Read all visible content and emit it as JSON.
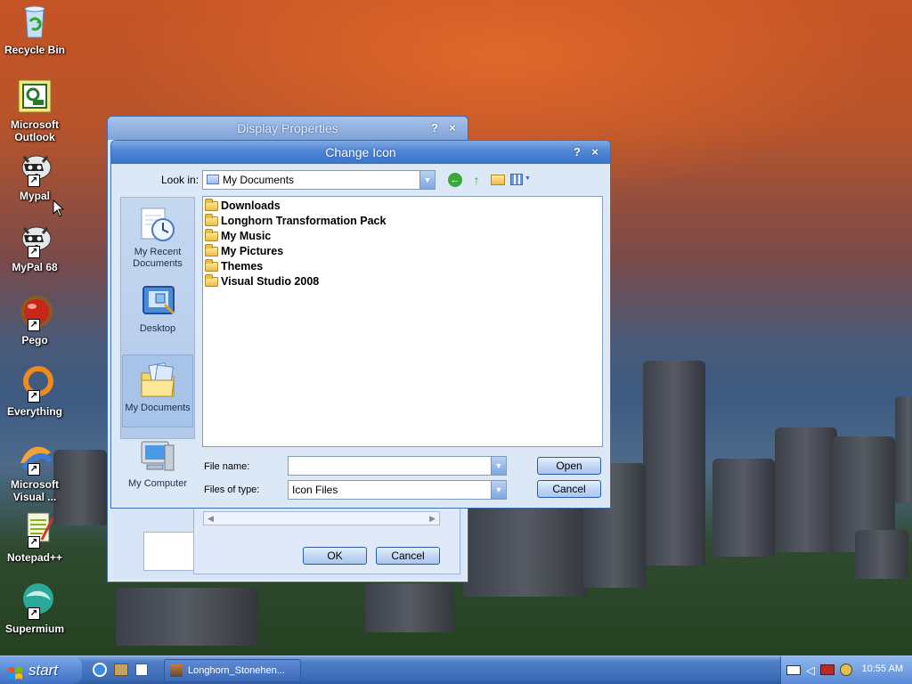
{
  "desktop": {
    "icons": [
      {
        "label": "Recycle Bin",
        "icon": "recycle-bin-icon"
      },
      {
        "label": "Microsoft Outlook",
        "icon": "outlook-icon"
      },
      {
        "label": "Mypal",
        "icon": "raccoon-icon"
      },
      {
        "label": "MyPal 68",
        "icon": "raccoon-icon"
      },
      {
        "label": "Pego",
        "icon": "red-ball-icon"
      },
      {
        "label": "Everything",
        "icon": "orange-ring-icon"
      },
      {
        "label": "Microsoft Visual ...",
        "icon": "visual-studio-icon"
      },
      {
        "label": "Notepad++",
        "icon": "notepad-plus-icon"
      },
      {
        "label": "Supermium",
        "icon": "supermium-icon"
      }
    ]
  },
  "display_properties": {
    "title": "Display Properties",
    "help": "?",
    "close": "×",
    "ok_label": "OK",
    "cancel_label": "Cancel"
  },
  "change_icon": {
    "title": "Change Icon",
    "help": "?",
    "close": "×",
    "look_in_label": "Look in:",
    "look_in_value": "My Documents",
    "places": [
      {
        "label": "My Recent Documents",
        "icon": "recent-documents-icon",
        "selected": false
      },
      {
        "label": "Desktop",
        "icon": "desktop-icon",
        "selected": false
      },
      {
        "label": "My Documents",
        "icon": "my-documents-icon",
        "selected": true
      },
      {
        "label": "My Computer",
        "icon": "my-computer-icon",
        "selected": false
      }
    ],
    "files": [
      {
        "name": "Downloads"
      },
      {
        "name": "Longhorn Transformation Pack"
      },
      {
        "name": "My Music"
      },
      {
        "name": "My Pictures"
      },
      {
        "name": "Themes"
      },
      {
        "name": "Visual Studio 2008"
      }
    ],
    "file_name_label": "File name:",
    "file_name_value": "",
    "file_type_label": "Files of type:",
    "file_type_value": "Icon Files",
    "open_label": "Open",
    "cancel_label": "Cancel"
  },
  "taskbar": {
    "start_label": "start",
    "task_label": "Longhorn_Stonehen...",
    "clock": "10:55 AM"
  },
  "colors": {
    "titlebar": "#3a73c9",
    "taskbar": "#3c6bb7",
    "dialog_bg": "#dce8f6"
  }
}
